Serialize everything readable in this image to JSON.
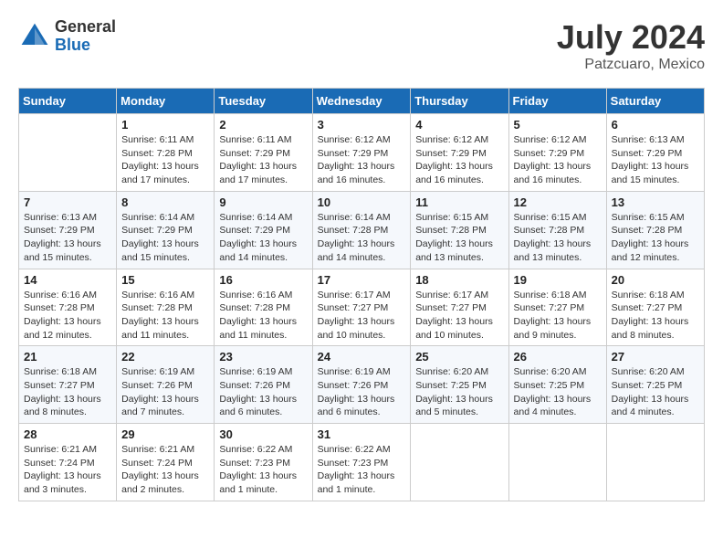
{
  "header": {
    "logo_general": "General",
    "logo_blue": "Blue",
    "month_title": "July 2024",
    "location": "Patzcuaro, Mexico"
  },
  "weekdays": [
    "Sunday",
    "Monday",
    "Tuesday",
    "Wednesday",
    "Thursday",
    "Friday",
    "Saturday"
  ],
  "weeks": [
    [
      {
        "day": "",
        "info": ""
      },
      {
        "day": "1",
        "info": "Sunrise: 6:11 AM\nSunset: 7:28 PM\nDaylight: 13 hours\nand 17 minutes."
      },
      {
        "day": "2",
        "info": "Sunrise: 6:11 AM\nSunset: 7:29 PM\nDaylight: 13 hours\nand 17 minutes."
      },
      {
        "day": "3",
        "info": "Sunrise: 6:12 AM\nSunset: 7:29 PM\nDaylight: 13 hours\nand 16 minutes."
      },
      {
        "day": "4",
        "info": "Sunrise: 6:12 AM\nSunset: 7:29 PM\nDaylight: 13 hours\nand 16 minutes."
      },
      {
        "day": "5",
        "info": "Sunrise: 6:12 AM\nSunset: 7:29 PM\nDaylight: 13 hours\nand 16 minutes."
      },
      {
        "day": "6",
        "info": "Sunrise: 6:13 AM\nSunset: 7:29 PM\nDaylight: 13 hours\nand 15 minutes."
      }
    ],
    [
      {
        "day": "7",
        "info": "Sunrise: 6:13 AM\nSunset: 7:29 PM\nDaylight: 13 hours\nand 15 minutes."
      },
      {
        "day": "8",
        "info": "Sunrise: 6:14 AM\nSunset: 7:29 PM\nDaylight: 13 hours\nand 15 minutes."
      },
      {
        "day": "9",
        "info": "Sunrise: 6:14 AM\nSunset: 7:29 PM\nDaylight: 13 hours\nand 14 minutes."
      },
      {
        "day": "10",
        "info": "Sunrise: 6:14 AM\nSunset: 7:28 PM\nDaylight: 13 hours\nand 14 minutes."
      },
      {
        "day": "11",
        "info": "Sunrise: 6:15 AM\nSunset: 7:28 PM\nDaylight: 13 hours\nand 13 minutes."
      },
      {
        "day": "12",
        "info": "Sunrise: 6:15 AM\nSunset: 7:28 PM\nDaylight: 13 hours\nand 13 minutes."
      },
      {
        "day": "13",
        "info": "Sunrise: 6:15 AM\nSunset: 7:28 PM\nDaylight: 13 hours\nand 12 minutes."
      }
    ],
    [
      {
        "day": "14",
        "info": "Sunrise: 6:16 AM\nSunset: 7:28 PM\nDaylight: 13 hours\nand 12 minutes."
      },
      {
        "day": "15",
        "info": "Sunrise: 6:16 AM\nSunset: 7:28 PM\nDaylight: 13 hours\nand 11 minutes."
      },
      {
        "day": "16",
        "info": "Sunrise: 6:16 AM\nSunset: 7:28 PM\nDaylight: 13 hours\nand 11 minutes."
      },
      {
        "day": "17",
        "info": "Sunrise: 6:17 AM\nSunset: 7:27 PM\nDaylight: 13 hours\nand 10 minutes."
      },
      {
        "day": "18",
        "info": "Sunrise: 6:17 AM\nSunset: 7:27 PM\nDaylight: 13 hours\nand 10 minutes."
      },
      {
        "day": "19",
        "info": "Sunrise: 6:18 AM\nSunset: 7:27 PM\nDaylight: 13 hours\nand 9 minutes."
      },
      {
        "day": "20",
        "info": "Sunrise: 6:18 AM\nSunset: 7:27 PM\nDaylight: 13 hours\nand 8 minutes."
      }
    ],
    [
      {
        "day": "21",
        "info": "Sunrise: 6:18 AM\nSunset: 7:27 PM\nDaylight: 13 hours\nand 8 minutes."
      },
      {
        "day": "22",
        "info": "Sunrise: 6:19 AM\nSunset: 7:26 PM\nDaylight: 13 hours\nand 7 minutes."
      },
      {
        "day": "23",
        "info": "Sunrise: 6:19 AM\nSunset: 7:26 PM\nDaylight: 13 hours\nand 6 minutes."
      },
      {
        "day": "24",
        "info": "Sunrise: 6:19 AM\nSunset: 7:26 PM\nDaylight: 13 hours\nand 6 minutes."
      },
      {
        "day": "25",
        "info": "Sunrise: 6:20 AM\nSunset: 7:25 PM\nDaylight: 13 hours\nand 5 minutes."
      },
      {
        "day": "26",
        "info": "Sunrise: 6:20 AM\nSunset: 7:25 PM\nDaylight: 13 hours\nand 4 minutes."
      },
      {
        "day": "27",
        "info": "Sunrise: 6:20 AM\nSunset: 7:25 PM\nDaylight: 13 hours\nand 4 minutes."
      }
    ],
    [
      {
        "day": "28",
        "info": "Sunrise: 6:21 AM\nSunset: 7:24 PM\nDaylight: 13 hours\nand 3 minutes."
      },
      {
        "day": "29",
        "info": "Sunrise: 6:21 AM\nSunset: 7:24 PM\nDaylight: 13 hours\nand 2 minutes."
      },
      {
        "day": "30",
        "info": "Sunrise: 6:22 AM\nSunset: 7:23 PM\nDaylight: 13 hours\nand 1 minute."
      },
      {
        "day": "31",
        "info": "Sunrise: 6:22 AM\nSunset: 7:23 PM\nDaylight: 13 hours\nand 1 minute."
      },
      {
        "day": "",
        "info": ""
      },
      {
        "day": "",
        "info": ""
      },
      {
        "day": "",
        "info": ""
      }
    ]
  ]
}
